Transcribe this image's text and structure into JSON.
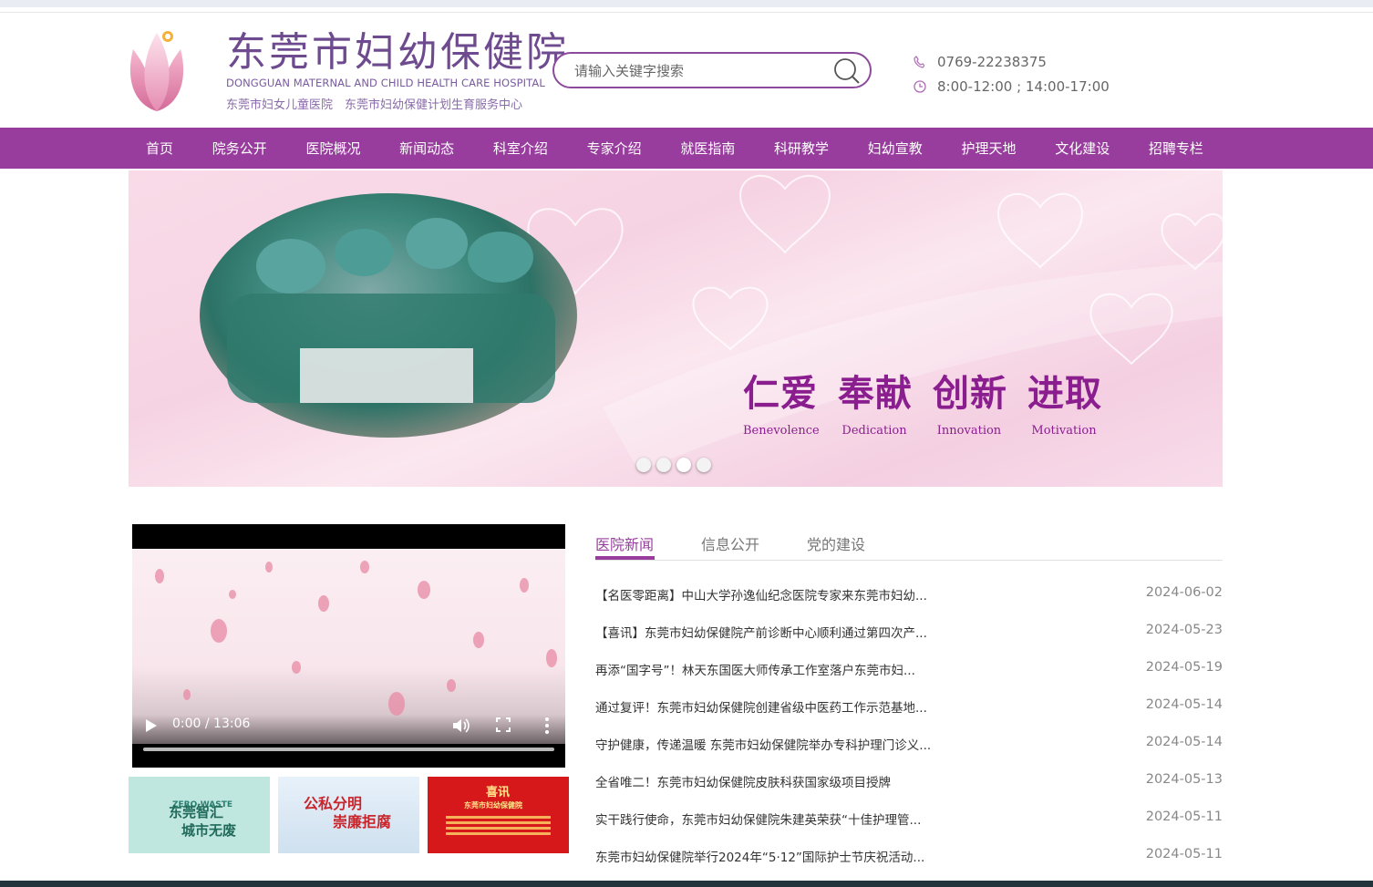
{
  "header": {
    "logo_title": "东莞市妇幼保健院",
    "logo_en": "DONGGUAN MATERNAL AND CHILD HEALTH CARE HOSPITAL",
    "logo_sub": "东莞市妇女儿童医院　东莞市妇幼保健计划生育服务中心",
    "search_placeholder": "请输入关键字搜索",
    "phone": "0769-22238375",
    "hours": "8:00-12:00 ; 14:00-17:00",
    "icons": {
      "phone": "phone-icon",
      "clock": "clock-icon",
      "search": "search-icon"
    }
  },
  "nav": {
    "items": [
      "首页",
      "院务公开",
      "医院概况",
      "新闻动态",
      "科室介绍",
      "专家介绍",
      "就医指南",
      "科研教学",
      "妇幼宣教",
      "护理天地",
      "文化建设",
      "招聘专栏"
    ]
  },
  "banner": {
    "slogans": [
      {
        "cn": "仁爱",
        "en": "Benevolence"
      },
      {
        "cn": "奉献",
        "en": "Dedication"
      },
      {
        "cn": "创新",
        "en": "Innovation"
      },
      {
        "cn": "进取",
        "en": "Motivation"
      }
    ],
    "slide_count": 4,
    "active_slide": 3
  },
  "video": {
    "time": "0:00 / 13:06",
    "progress": 0
  },
  "thumbs": [
    {
      "line1": "东莞智汇",
      "line2": "城市无废",
      "tag": "ZERO-WASTE"
    },
    {
      "line1": "公私分明",
      "line2": "崇廉拒腐"
    },
    {
      "line1": "喜讯",
      "line2": "东莞市妇幼保健院"
    }
  ],
  "tabs": [
    "医院新闻",
    "信息公开",
    "党的建设"
  ],
  "news": [
    {
      "title": "【名医零距离】中山大学孙逸仙纪念医院专家来东莞市妇幼...",
      "date": "2024-06-02"
    },
    {
      "title": "【喜讯】东莞市妇幼保健院产前诊断中心顺利通过第四次产...",
      "date": "2024-05-23"
    },
    {
      "title": "再添“国字号”！林天东国医大师传承工作室落户东莞市妇...",
      "date": "2024-05-19"
    },
    {
      "title": "通过复评！东莞市妇幼保健院创建省级中医药工作示范基地...",
      "date": "2024-05-14"
    },
    {
      "title": "守护健康，传递温暖 东莞市妇幼保健院举办专科护理门诊义...",
      "date": "2024-05-14"
    },
    {
      "title": "全省唯二！东莞市妇幼保健院皮肤科获国家级项目授牌",
      "date": "2024-05-13"
    },
    {
      "title": "实干践行使命，东莞市妇幼保健院朱建英荣获“十佳护理管...",
      "date": "2024-05-11"
    },
    {
      "title": "东莞市妇幼保健院举行2024年“5·12”国际护士节庆祝活动...",
      "date": "2024-05-11"
    }
  ],
  "colors": {
    "brand": "#983d9e",
    "accent": "#8a1e8f",
    "footer": "#23343c"
  }
}
